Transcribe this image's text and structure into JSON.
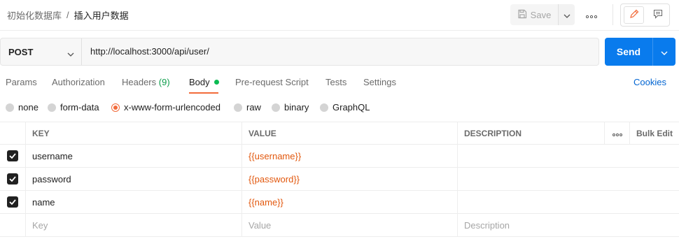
{
  "header": {
    "breadcrumb_parent": "初始化数据库",
    "breadcrumb_sep": "/",
    "breadcrumb_current": "插入用户数据",
    "save_label": "Save"
  },
  "request": {
    "method": "POST",
    "url": "http://localhost:3000/api/user/",
    "send_label": "Send"
  },
  "tabs": [
    {
      "label": "Params"
    },
    {
      "label": "Authorization"
    },
    {
      "label": "Headers",
      "count": "(9)"
    },
    {
      "label": "Body",
      "active": true
    },
    {
      "label": "Pre-request Script"
    },
    {
      "label": "Tests"
    },
    {
      "label": "Settings"
    }
  ],
  "cookies_label": "Cookies",
  "body_types": [
    {
      "label": "none"
    },
    {
      "label": "form-data"
    },
    {
      "label": "x-www-form-urlencoded",
      "selected": true
    },
    {
      "label": "raw"
    },
    {
      "label": "binary"
    },
    {
      "label": "GraphQL"
    }
  ],
  "table": {
    "headers": {
      "key": "KEY",
      "value": "VALUE",
      "description": "DESCRIPTION",
      "bulk_edit": "Bulk Edit"
    },
    "rows": [
      {
        "key": "username",
        "value": "{{username}}",
        "description": "",
        "checked": true
      },
      {
        "key": "password",
        "value": "{{password}}",
        "description": "",
        "checked": true
      },
      {
        "key": "name",
        "value": "{{name}}",
        "description": "",
        "checked": true
      }
    ],
    "placeholders": {
      "key": "Key",
      "value": "Value",
      "description": "Description"
    }
  },
  "colors": {
    "accent": "#f26b3a",
    "send": "#097bed",
    "variable": "#e2580e",
    "link": "#0265d2",
    "active_dot": "#0cbb52"
  }
}
